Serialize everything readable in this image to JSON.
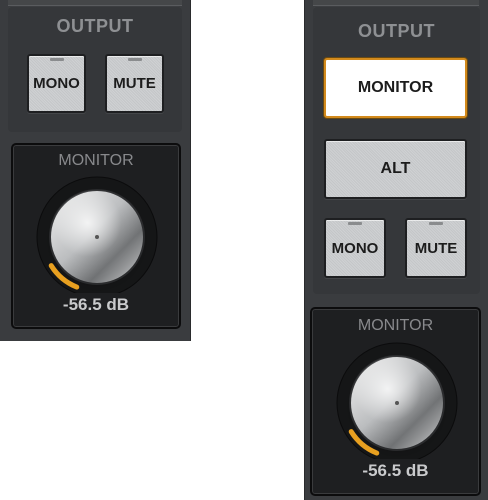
{
  "left_strip": {
    "output": {
      "title": "OUTPUT",
      "buttons": [
        {
          "label": "MONO"
        },
        {
          "label": "MUTE"
        }
      ]
    },
    "monitor": {
      "title": "MONITOR",
      "level_text": "-56.5 dB",
      "level_fraction": 0.12
    }
  },
  "right_strip": {
    "output": {
      "title": "OUTPUT",
      "monitor_button": "MONITOR",
      "alt_button": "ALT",
      "buttons": [
        {
          "label": "MONO"
        },
        {
          "label": "MUTE"
        }
      ]
    },
    "monitor": {
      "title": "MONITOR",
      "level_text": "-56.5 dB",
      "level_fraction": 0.12
    }
  },
  "colors": {
    "accent": "#e8a020",
    "panel": "#3a3c3f",
    "monitor_bg": "#1e1f21"
  }
}
